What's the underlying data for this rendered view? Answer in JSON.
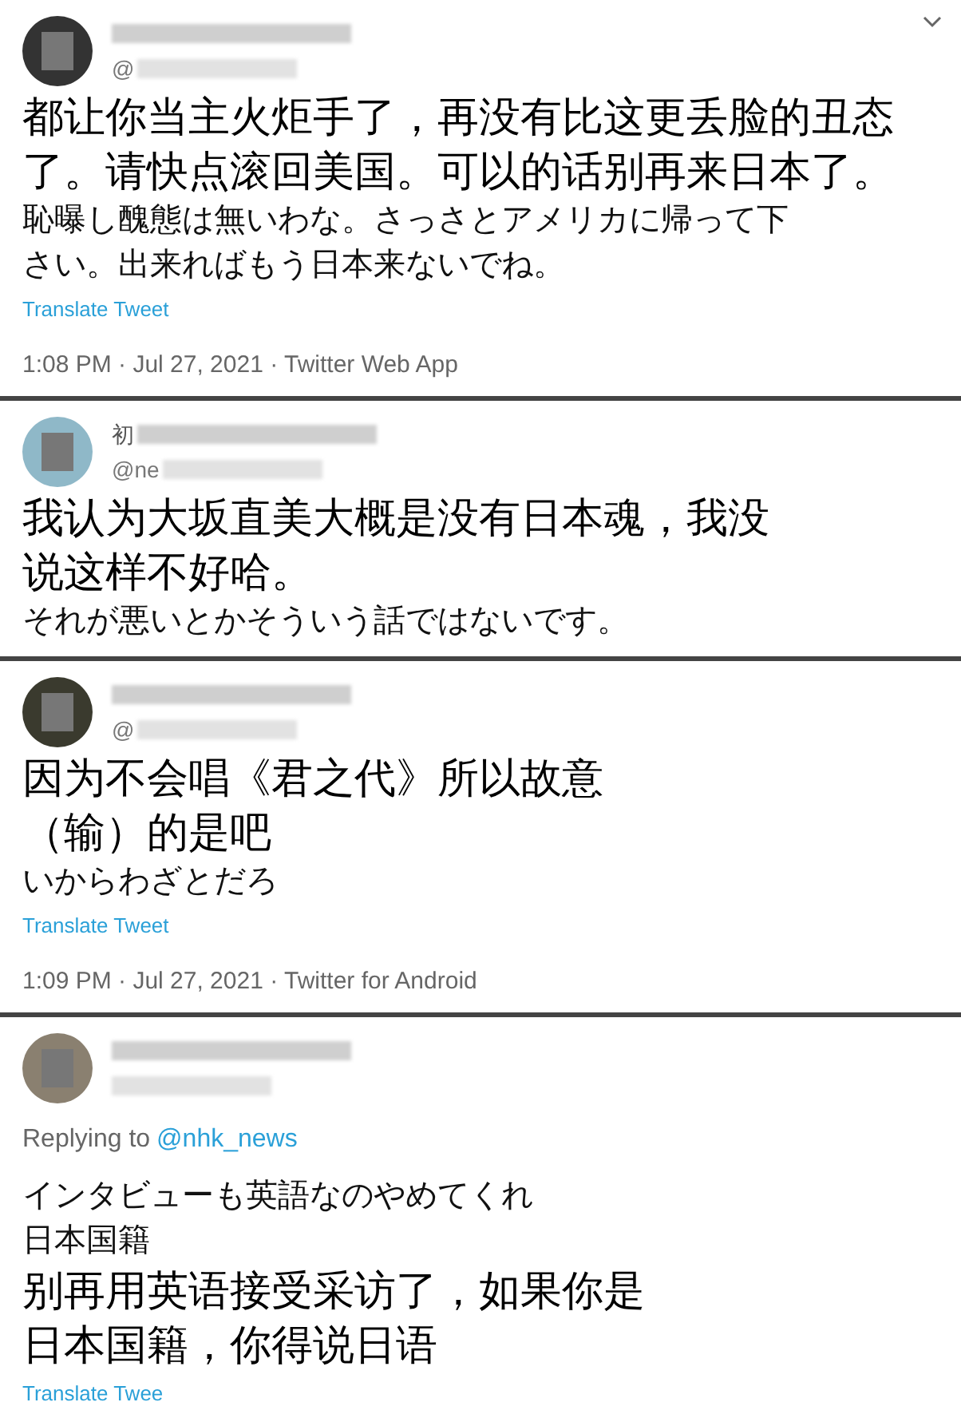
{
  "tweets": [
    {
      "handle": "@",
      "menu": true,
      "blocks": [
        {
          "kind": "caption",
          "text": "都让你当主火炬手了，再没有比这更丢脸的丑态"
        },
        {
          "kind": "caption",
          "text": "了。请快点滚回美国。可以的话别再来日本了。"
        },
        {
          "kind": "text",
          "text": "恥曝し醜態は無いわな。さっさとアメリカに帰って下"
        },
        {
          "kind": "text",
          "text": "さい。出来ればもう日本来ないでね。"
        },
        {
          "kind": "translate",
          "text": "Translate Tweet"
        },
        {
          "kind": "meta",
          "text": "1:08 PM · Jul 27, 2021 · Twitter Web App"
        }
      ]
    },
    {
      "name": "初",
      "handle": "@ne",
      "blocks": [
        {
          "kind": "caption",
          "text": "我认为大坂直美大概是没有日本魂，我没"
        },
        {
          "kind": "caption",
          "text": "说这样不好哈。"
        },
        {
          "kind": "text",
          "text": "それが悪いとかそういう話ではないです。"
        }
      ]
    },
    {
      "handle": "@",
      "blocks": [
        {
          "kind": "caption",
          "text": "因为不会唱《君之代》所以故意"
        },
        {
          "kind": "caption",
          "text": "（输）的是吧"
        },
        {
          "kind": "text",
          "text": "いからわざとだろ"
        },
        {
          "kind": "translate",
          "text": "Translate Tweet"
        },
        {
          "kind": "meta",
          "text": "1:09 PM · Jul 27, 2021 · Twitter for Android"
        }
      ]
    },
    {
      "blocks": [
        {
          "kind": "reply",
          "text": "Replying to",
          "link": "@nhk_news"
        },
        {
          "kind": "text",
          "text": "インタビューも英語なのやめてくれ"
        },
        {
          "kind": "text",
          "text": "日本国籍"
        },
        {
          "kind": "caption",
          "text": "别再用英语接受采访了，如果你是"
        },
        {
          "kind": "caption",
          "text": "日本国籍，你得说日语"
        },
        {
          "kind": "translate",
          "text": "Translate Twee"
        }
      ]
    }
  ]
}
